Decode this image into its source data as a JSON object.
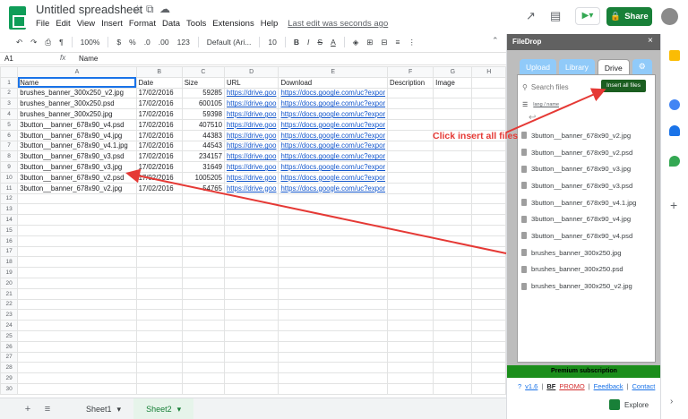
{
  "titlebar": {
    "doc_title": "Untitled spreadsheet",
    "menu": [
      "File",
      "Edit",
      "View",
      "Insert",
      "Format",
      "Data",
      "Tools",
      "Extensions",
      "Help"
    ],
    "last_edit": "Last edit was seconds ago",
    "share_label": "Share"
  },
  "toolbar": {
    "zoom": "100%",
    "currency": "$",
    "percent": "%",
    "dec_less": ".0",
    "dec_more": ".00",
    "format": "123",
    "font": "Default (Ari...",
    "font_size": "10",
    "bold": "B",
    "italic": "I",
    "strike": "S",
    "text_color": "A"
  },
  "formula_bar": {
    "cell_ref": "A1",
    "fx": "fx",
    "value": "Name"
  },
  "grid": {
    "columns": [
      "A",
      "B",
      "C",
      "D",
      "E",
      "F",
      "G",
      "H"
    ],
    "header_row": [
      "Name",
      "Date",
      "Size",
      "URL",
      "Download",
      "Description",
      "Image"
    ],
    "rows": [
      [
        "brushes_banner_300x250_v2.jpg",
        "17/02/2016",
        "59285",
        "https://drive.goo",
        "https://docs.google.com/uc?expor"
      ],
      [
        "brushes_banner_300x250.psd",
        "17/02/2016",
        "600105",
        "https://drive.goo",
        "https://docs.google.com/uc?expor"
      ],
      [
        "brushes_banner_300x250.jpg",
        "17/02/2016",
        "59398",
        "https://drive.goo",
        "https://docs.google.com/uc?expor"
      ],
      [
        "3button__banner_678x90_v4.psd",
        "17/02/2016",
        "407510",
        "https://drive.goo",
        "https://docs.google.com/uc?expor"
      ],
      [
        "3button__banner_678x90_v4.jpg",
        "17/02/2016",
        "44383",
        "https://drive.goo",
        "https://docs.google.com/uc?expor"
      ],
      [
        "3button__banner_678x90_v4.1.jpg",
        "17/02/2016",
        "44543",
        "https://drive.goo",
        "https://docs.google.com/uc?expor"
      ],
      [
        "3button__banner_678x90_v3.psd",
        "17/02/2016",
        "234157",
        "https://drive.goo",
        "https://docs.google.com/uc?expor"
      ],
      [
        "3button__banner_678x90_v3.jpg",
        "17/02/2016",
        "31649",
        "https://drive.goo",
        "https://docs.google.com/uc?expor"
      ],
      [
        "3button__banner_678x90_v2.psd",
        "17/02/2016",
        "1005205",
        "https://drive.goo",
        "https://docs.google.com/uc?expor"
      ],
      [
        "3button__banner_678x90_v2.jpg",
        "17/02/2016",
        "54765",
        "https://drive.goo",
        "https://docs.google.com/uc?expor"
      ]
    ],
    "row_numbers": [
      "1",
      "2",
      "3",
      "4",
      "5",
      "6",
      "7",
      "8",
      "9",
      "10",
      "11",
      "12",
      "13",
      "14",
      "15",
      "16",
      "17",
      "18",
      "19",
      "20",
      "21",
      "22",
      "23",
      "24",
      "25",
      "26",
      "27",
      "28",
      "29",
      "30"
    ]
  },
  "sheet_tabs": {
    "tabs": [
      "Sheet1",
      "Sheet2"
    ],
    "active_index": 1
  },
  "filedrop": {
    "title": "FileDrop",
    "tabs": [
      "Upload",
      "Library",
      "Drive"
    ],
    "active_tab": "Drive",
    "search_placeholder": "Search files",
    "insert_all_label": "Insert all files",
    "sort_label": "lang / name",
    "files": [
      "3button__banner_678x90_v2.jpg",
      "3button__banner_678x90_v2.psd",
      "3button__banner_678x90_v3.jpg",
      "3button__banner_678x90_v3.psd",
      "3button__banner_678x90_v4.1.jpg",
      "3button__banner_678x90_v4.jpg",
      "3button__banner_678x90_v4.psd",
      "brushes_banner_300x250.jpg",
      "brushes_banner_300x250.psd",
      "brushes_banner_300x250_v2.jpg"
    ],
    "premium_label": "Premium subscription",
    "footer": {
      "help": "?",
      "version": "v1.6",
      "bf": "BF",
      "promo": "PROMO",
      "feedback": "Feedback",
      "contact": "Contact"
    },
    "explore_label": "Explore"
  },
  "annotation": {
    "text": "Click insert all files",
    "color": "#e53935"
  },
  "colors": {
    "share_green": "#188038",
    "insert_green": "#1b5e20",
    "premium_green": "#1b8e1b",
    "link_blue": "#1155cc",
    "tab_blue": "#90caf9"
  }
}
